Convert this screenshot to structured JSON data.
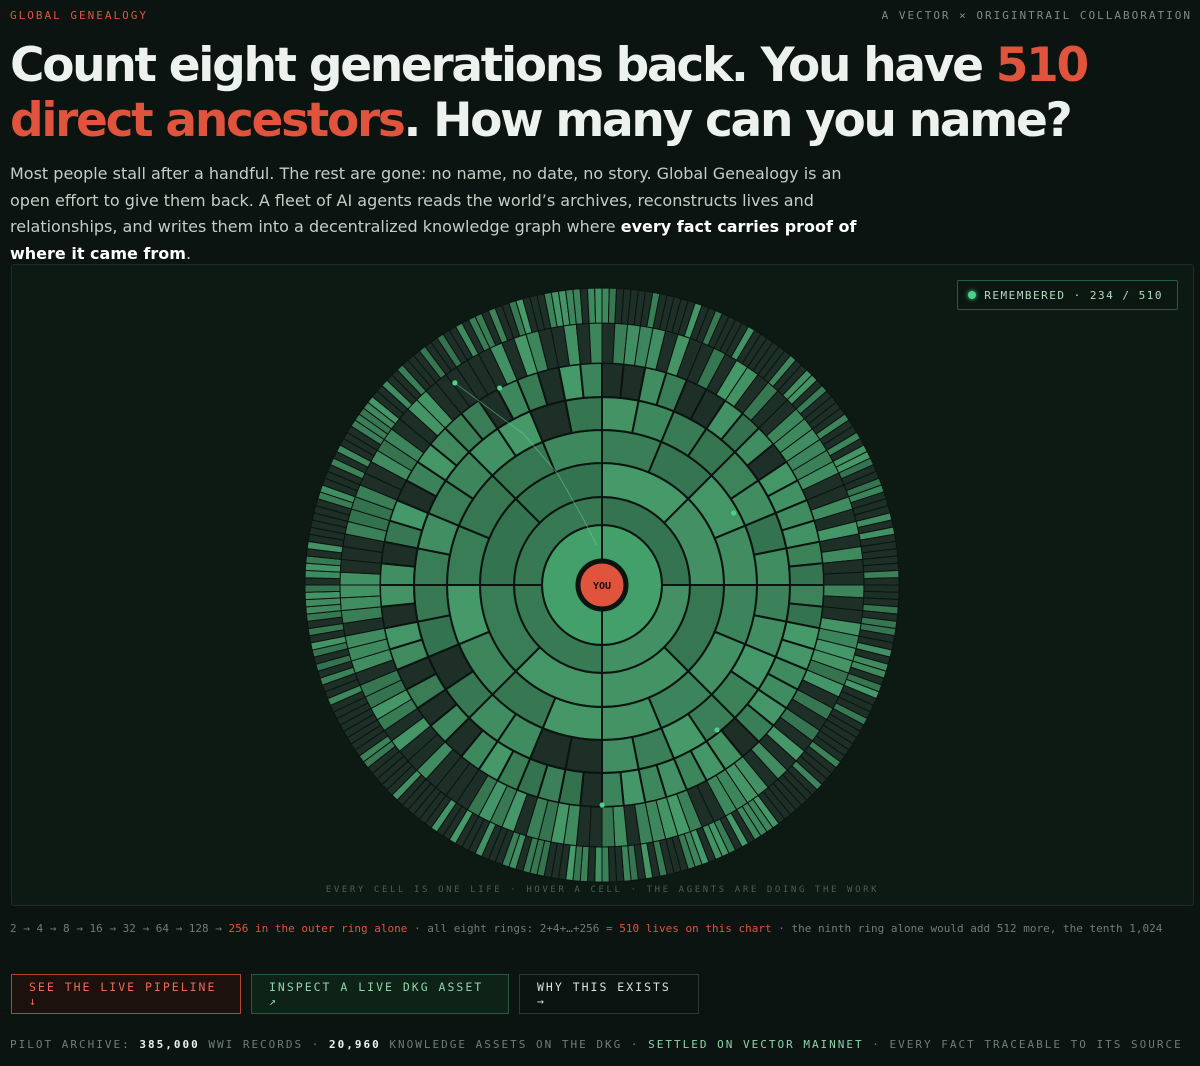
{
  "header": {
    "brand": "GLOBAL GENEALOGY",
    "collab": "A VECTOR × ORIGINTRAIL COLLABORATION"
  },
  "hero": {
    "headline_part1": "Count eight generations back. You have ",
    "headline_highlight1": "510",
    "headline_highlight2": "direct ancestors",
    "headline_part2": ". How many can you name?",
    "intro_part1": "Most people stall after a handful. The rest are gone: no name, no date, no story. Global Genealogy is an open effort to give them back. A fleet of AI agents reads the world’s archives, reconstructs lives and relationships, and writes them into a decentralized knowledge graph where ",
    "intro_bold": "every fact carries proof of where it came from",
    "intro_part2": "."
  },
  "chart": {
    "center_label": "YOU",
    "remembered_text": "REMEMBERED · 234 / 510",
    "remembered": 234,
    "total": 510,
    "rings": [
      2,
      4,
      8,
      16,
      32,
      64,
      128,
      256
    ],
    "caption": "EVERY CELL IS ONE LIFE · HOVER A CELL · THE AGENTS ARE DOING THE WORK",
    "colors": {
      "remembered": "#3f8a5f",
      "unknown": "#1d2f27",
      "center": "#e0543d",
      "stroke": "#0b1410",
      "accent": "#4fd089"
    }
  },
  "math": {
    "seq": "2 → 4 → 8 → 16 → 32 → 64 → 128 → ",
    "outer": "256 in the outer ring alone",
    "mid": " · all eight rings: 2+4+…+256 = ",
    "total": "510 lives on this chart",
    "tail": " · the ninth ring alone would add 512 more, the tenth 1,024"
  },
  "buttons": {
    "pipeline": "SEE THE LIVE PIPELINE ↓",
    "dkg": "INSPECT A LIVE DKG ASSET ↗",
    "why": "WHY THIS EXISTS →"
  },
  "footer": {
    "l1": "PILOT ARCHIVE: ",
    "records": "385,000",
    "l2": " WWI RECORDS · ",
    "assets": "20,960",
    "l3": " KNOWLEDGE ASSETS ON THE DKG · ",
    "settled": "SETTLED ON VECTOR MAINNET",
    "l4": " · EVERY FACT TRACEABLE TO ITS SOURCE"
  }
}
